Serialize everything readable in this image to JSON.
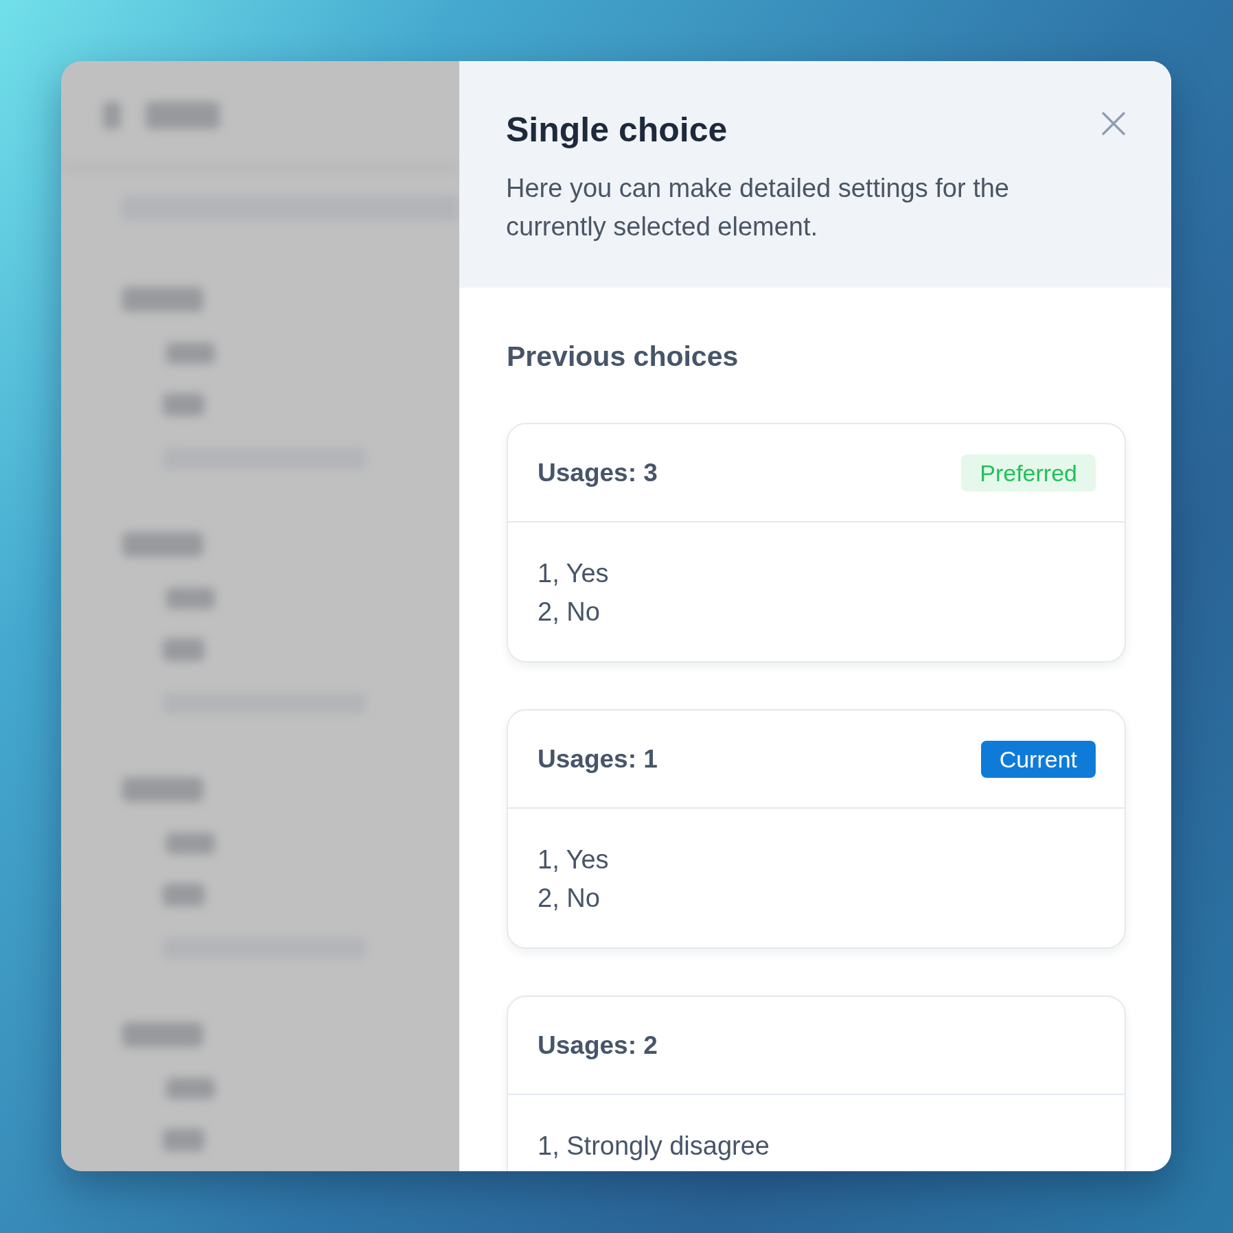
{
  "drawer": {
    "title": "Single choice",
    "description": "Here you can make detailed settings for the currently selected element."
  },
  "section": {
    "heading": "Previous choices"
  },
  "choices": [
    {
      "usages": "Usages: 3",
      "badge": {
        "kind": "preferred",
        "label": "Preferred"
      },
      "options": [
        "1, Yes",
        "2, No"
      ]
    },
    {
      "usages": "Usages: 1",
      "badge": {
        "kind": "current",
        "label": "Current"
      },
      "options": [
        "1, Yes",
        "2, No"
      ]
    },
    {
      "usages": "Usages: 2",
      "options": [
        "1, Strongly disagree"
      ]
    }
  ]
}
